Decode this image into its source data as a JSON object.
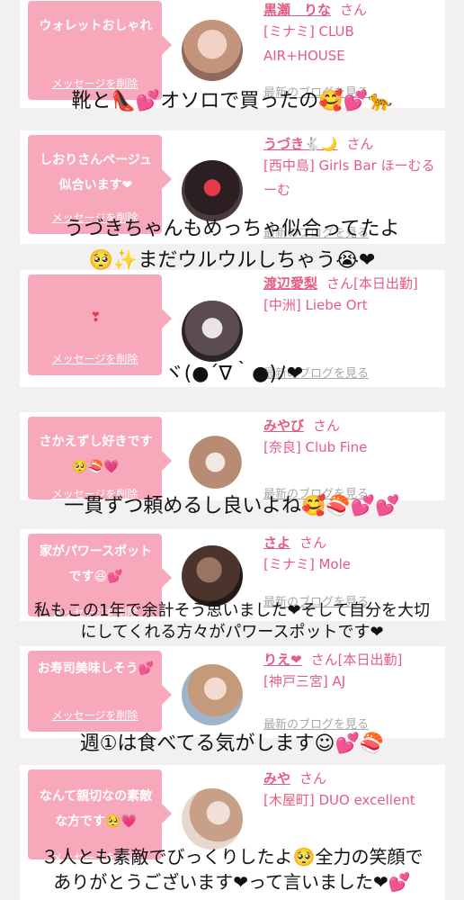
{
  "delete_label": "メッセージを削除",
  "blog_label": "最新のブログを見る",
  "san": "さん",
  "cards": [
    {
      "message": "ウォレットおしゃれ",
      "name": "黒瀬　りな",
      "extra": "",
      "shop": "[ミナミ] CLUB AIR+HOUSE",
      "avatar_color": "#d9b09c"
    },
    {
      "message": "しおりさんページュ似合います❤",
      "name": "うづき🐇🌙",
      "extra": "",
      "shop": "[西中島] Girls Bar ほーむるーむ",
      "avatar_color": "#3b2b2e"
    },
    {
      "message": "❣",
      "name": "渡辺愛梨",
      "extra": "[本日出勤]",
      "shop": "[中洲] Liebe Ort",
      "avatar_color": "#7d6d74"
    },
    {
      "message": "さかえずし好きです🥺🍣💗",
      "name": "みやび",
      "extra": "",
      "shop": "[奈良] Club Fine",
      "avatar_color": "#b88c74"
    },
    {
      "message": "家がパワースポットです😆💕",
      "name": "さよ",
      "extra": "",
      "shop": "[ミナミ] Mole",
      "avatar_color": "#6b5044"
    },
    {
      "message": "お寿司美味しそう💕",
      "name": "りえ❤",
      "extra": "[本日出勤]",
      "shop": "[神戸三宮] AJ",
      "avatar_color": "#cfd6df"
    },
    {
      "message": "なんて親切なの素敵な方です🥺💗",
      "name": "みや",
      "extra": "",
      "shop": "[木屋町] DUO excellent",
      "avatar_color": "#d8c2b4"
    }
  ],
  "captions": [
    "靴と👠💕オソロで買ったの🥰💕🐆",
    "うづきちゃんもめっちゃ似合ってたよ",
    "🥺✨まだウルウルしちゃう😭❤",
    "ヾ(●´∇｀●)ﾉ❤",
    "一貫ずつ頼めるし良いよね🥰🍣💕💕",
    "私もこの1年で余計そう思いました❤そして自分を大切",
    "にしてくれる方々がパワースポットです❤",
    "週①は食べてる気がします☺💕🍣",
    "３人とも素敵でびっくりしたよ🥺全力の笑顔で",
    "ありがとうございます❤って言いました❤💕"
  ]
}
